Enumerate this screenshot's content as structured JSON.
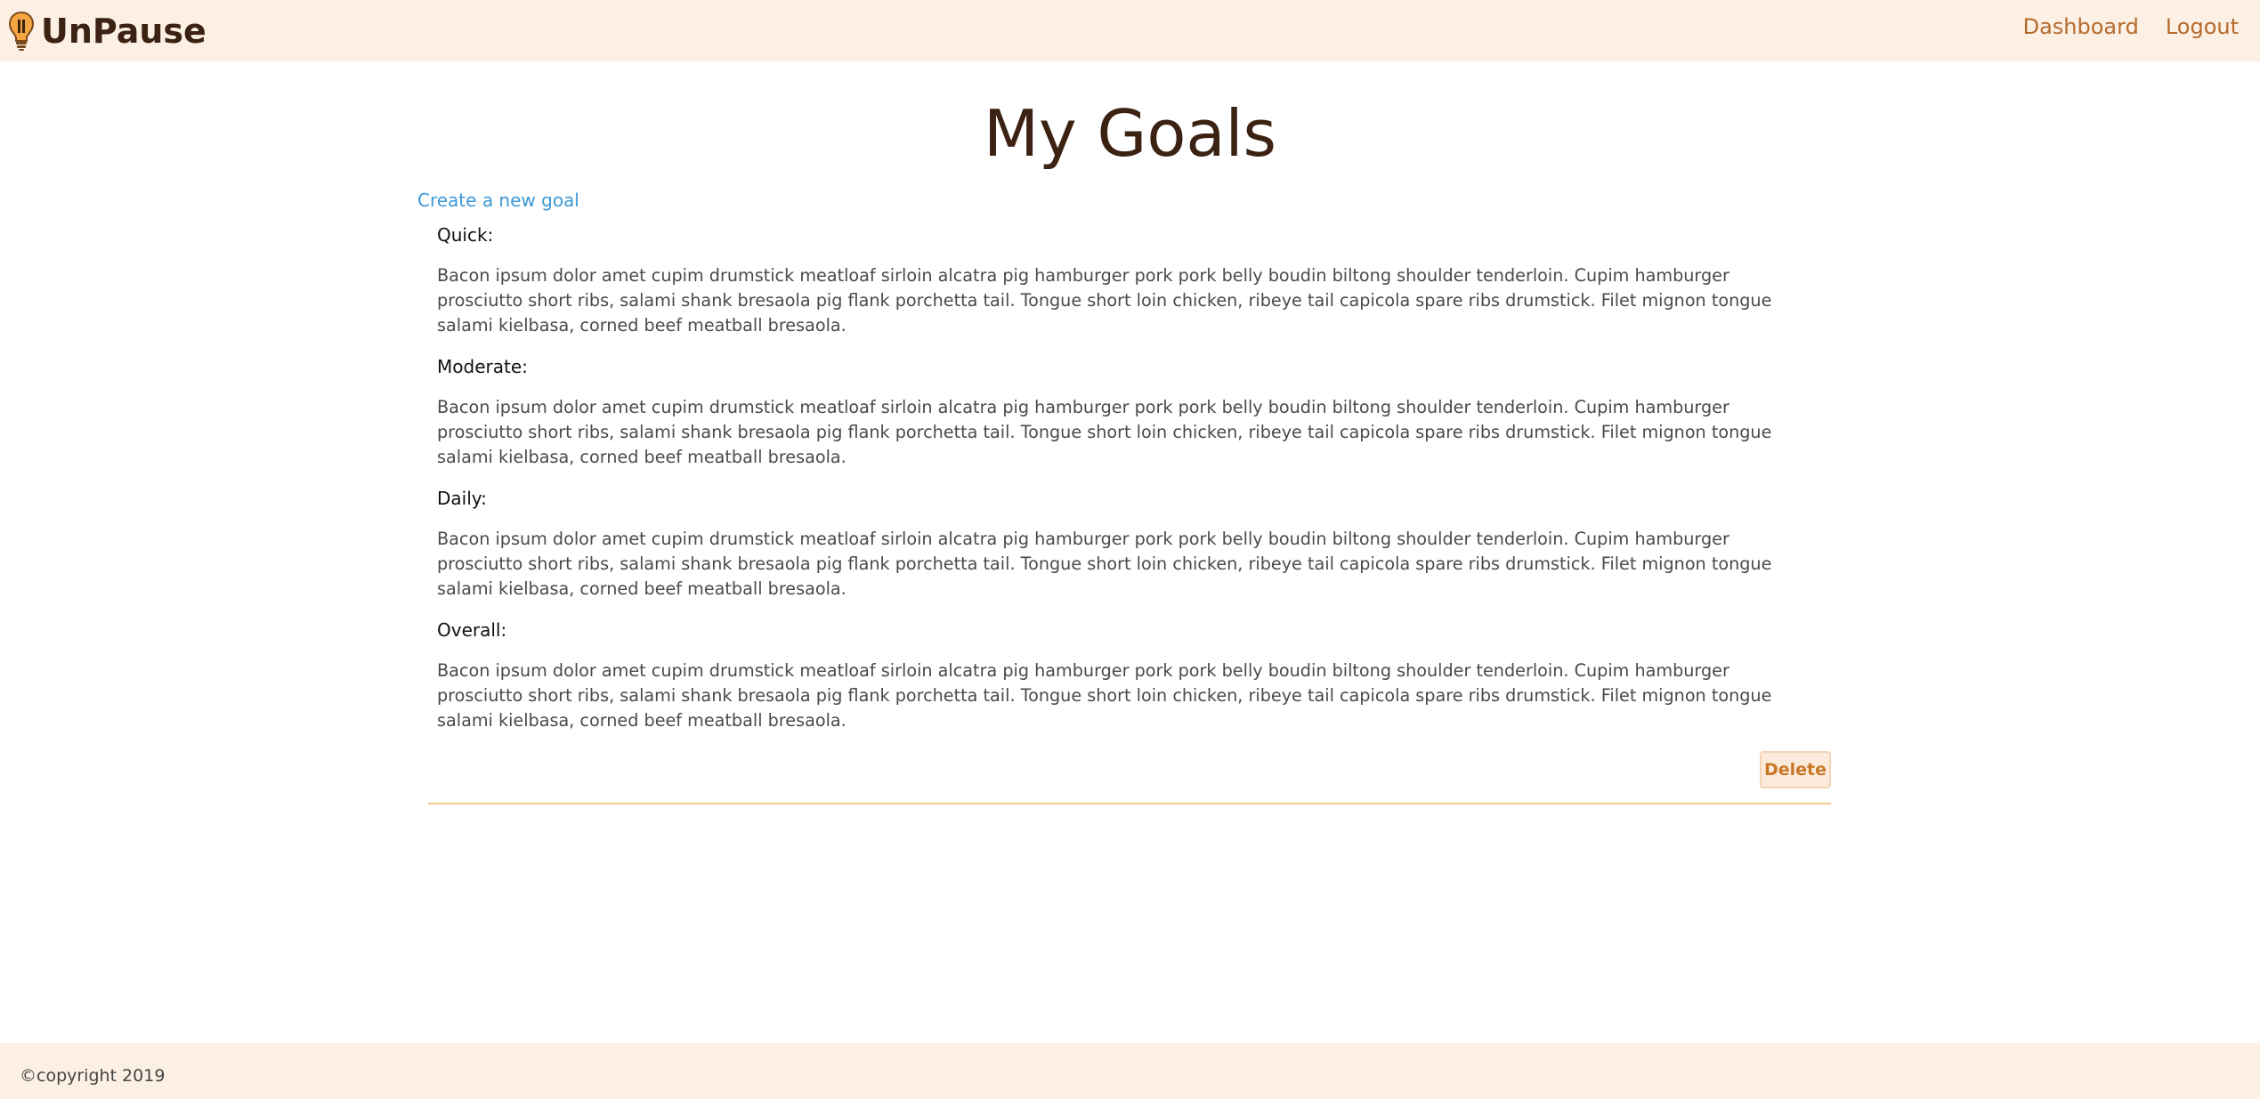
{
  "navbar": {
    "brand": "UnPause",
    "brand_icon": "lightbulb-pause-icon",
    "links": [
      "Dashboard",
      "Logout"
    ],
    "background": "#fcf0e4",
    "link_color": "#b56a2c"
  },
  "page": {
    "title": "My Goals",
    "create_link": "Create a new goal"
  },
  "goals": [
    {
      "sections": [
        {
          "label": "Quick:",
          "text": "Bacon ipsum dolor amet cupim drumstick meatloaf sirloin alcatra pig hamburger pork pork belly boudin biltong shoulder tenderloin. Cupim hamburger prosciutto short ribs, salami shank bresaola pig flank porchetta tail. Tongue short loin chicken, ribeye tail capicola spare ribs drumstick. Filet mignon tongue salami kielbasa, corned beef meatball bresaola."
        },
        {
          "label": "Moderate:",
          "text": "Bacon ipsum dolor amet cupim drumstick meatloaf sirloin alcatra pig hamburger pork pork belly boudin biltong shoulder tenderloin. Cupim hamburger prosciutto short ribs, salami shank bresaola pig flank porchetta tail. Tongue short loin chicken, ribeye tail capicola spare ribs drumstick. Filet mignon tongue salami kielbasa, corned beef meatball bresaola."
        },
        {
          "label": "Daily:",
          "text": "Bacon ipsum dolor amet cupim drumstick meatloaf sirloin alcatra pig hamburger pork pork belly boudin biltong shoulder tenderloin. Cupim hamburger prosciutto short ribs, salami shank bresaola pig flank porchetta tail. Tongue short loin chicken, ribeye tail capicola spare ribs drumstick. Filet mignon tongue salami kielbasa, corned beef meatball bresaola."
        },
        {
          "label": "Overall:",
          "text": "Bacon ipsum dolor amet cupim drumstick meatloaf sirloin alcatra pig hamburger pork pork belly boudin biltong shoulder tenderloin. Cupim hamburger prosciutto short ribs, salami shank bresaola pig flank porchetta tail. Tongue short loin chicken, ribeye tail capicola spare ribs drumstick. Filet mignon tongue salami kielbasa, corned beef meatball bresaola."
        }
      ],
      "delete_label": "Delete"
    }
  ],
  "footer": {
    "copyright": "©copyright 2019"
  },
  "colors": {
    "accent": "#b56a2c",
    "link_blue": "#3d98d6",
    "divider": "#f5c78a",
    "title": "#3b2212"
  }
}
